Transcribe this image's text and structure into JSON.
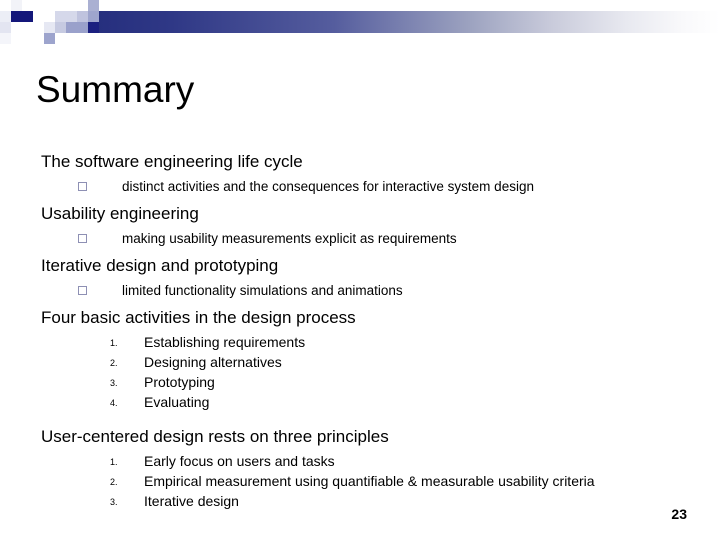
{
  "slide": {
    "title": "Summary",
    "page_number": "23",
    "accent_color": "#262f7e",
    "bullet_color": "#8e90b4",
    "text_color": "#000000",
    "decoration": {
      "gradient_from": "#262f7e",
      "gradient_to": "#ffffff",
      "mosaic_icon": "mosaic-squares"
    }
  },
  "content": {
    "section1": {
      "heading": "The software engineering life cycle",
      "bullets": [
        {
          "marker": "hollow-square",
          "text": "distinct activities and the consequences for interactive system design"
        }
      ]
    },
    "section2": {
      "heading": "Usability engineering",
      "bullets": [
        {
          "marker": "hollow-square",
          "text": "making usability measurements explicit as requirements"
        }
      ]
    },
    "section3": {
      "heading": "Iterative design and prototyping",
      "bullets": [
        {
          "marker": "hollow-square",
          "text": "limited functionality simulations and animations"
        }
      ]
    },
    "section4": {
      "heading": "Four basic activities in the design process",
      "numbered": [
        {
          "index": "1.",
          "text": "Establishing requirements"
        },
        {
          "index": "2.",
          "text": "Designing alternatives"
        },
        {
          "index": "3.",
          "text": "Prototyping"
        },
        {
          "index": "4.",
          "text": "Evaluating"
        }
      ]
    },
    "section5": {
      "heading": "User-centered design rests on three principles",
      "numbered": [
        {
          "index": "1.",
          "text": "Early focus on users and tasks"
        },
        {
          "index": "2.",
          "text": "Empirical measurement using quantifiable & measurable usability criteria"
        },
        {
          "index": "3.",
          "text": "Iterative design"
        }
      ]
    }
  }
}
